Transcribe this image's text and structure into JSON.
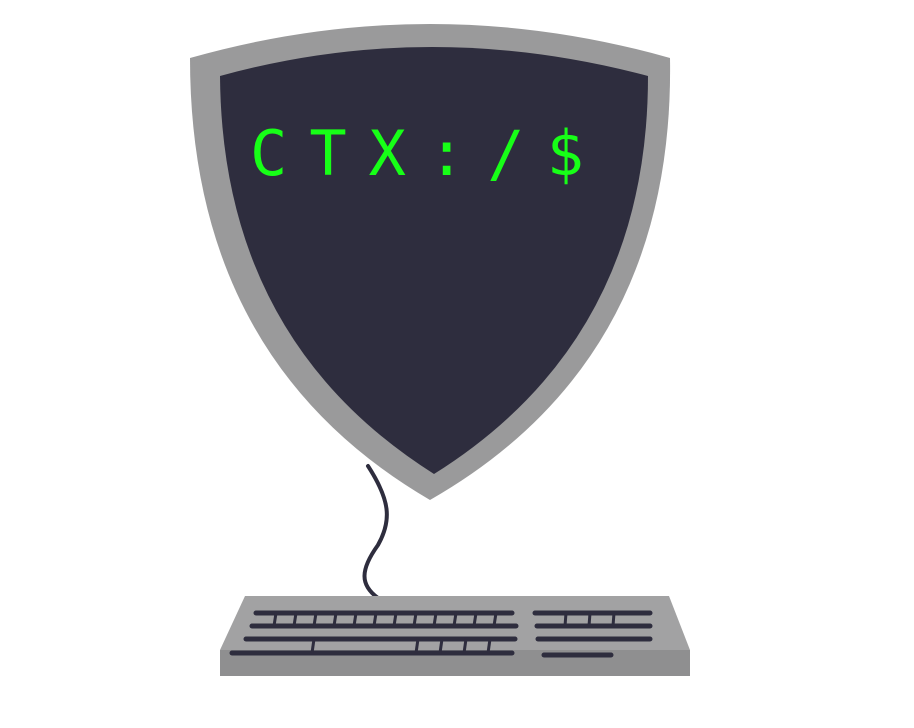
{
  "logo": {
    "prompt_text": "CTX:/$",
    "icons": [
      "shield-icon",
      "keyboard-icon",
      "cable-icon"
    ]
  },
  "colors": {
    "shield_border": "#9a9a9b",
    "shield_face": "#2e2d3e",
    "prompt_green": "#17ff17",
    "keyboard_body": "#9a9a9b",
    "keyboard_keys": "#2e2d3e",
    "cable": "#2e2d3e",
    "background": "#ffffff"
  }
}
